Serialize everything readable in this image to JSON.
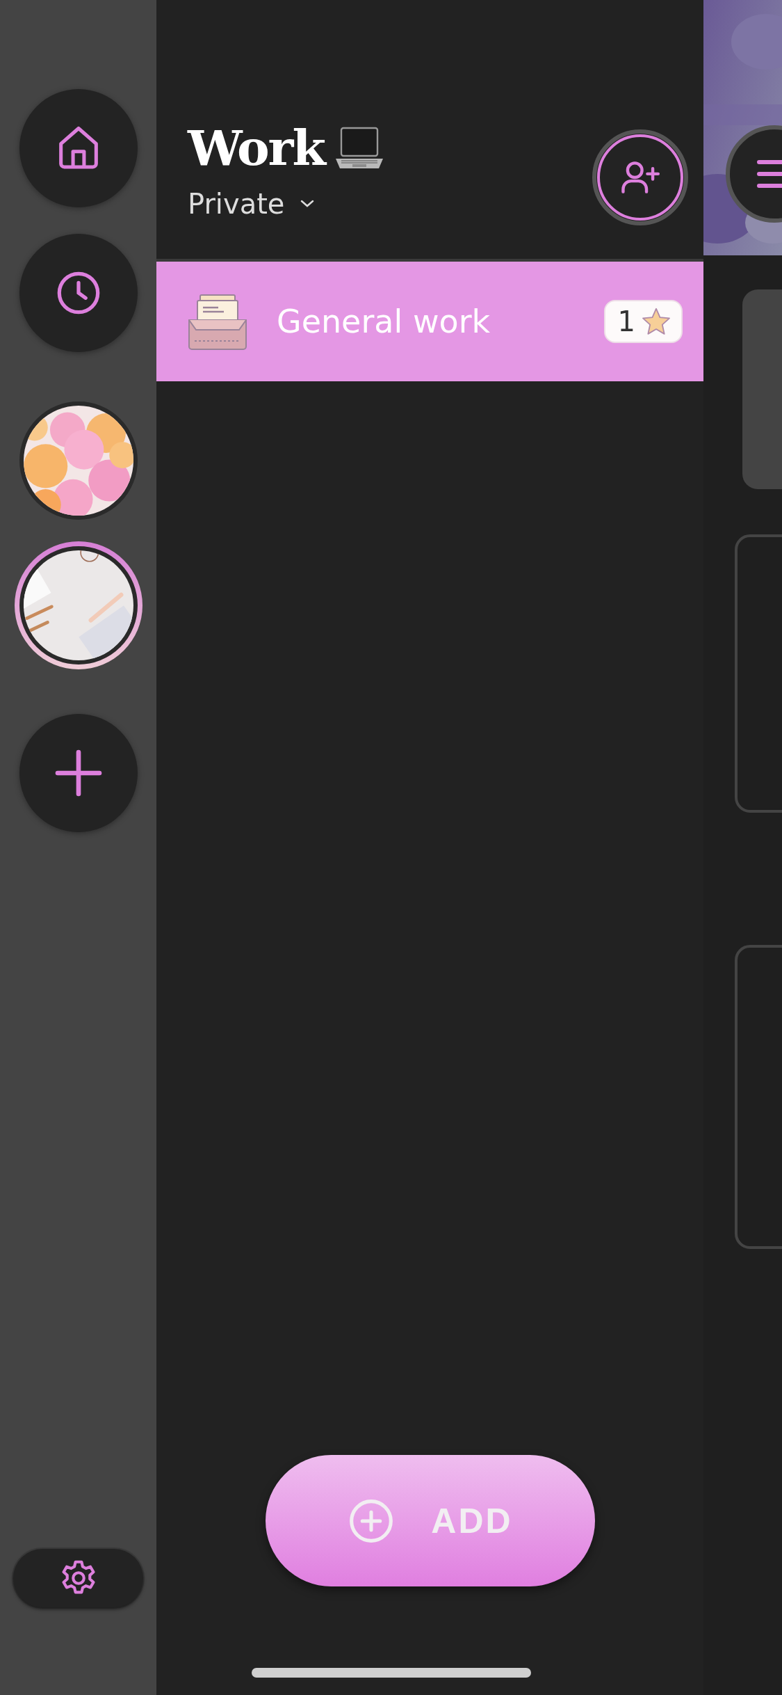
{
  "rail": {
    "items": [
      {
        "kind": "home",
        "selected": false
      },
      {
        "kind": "history",
        "selected": false
      },
      {
        "kind": "picture",
        "selected": false
      },
      {
        "kind": "picture",
        "selected": true
      },
      {
        "kind": "add",
        "selected": false
      }
    ]
  },
  "header": {
    "title": "Work",
    "subtitle": "Private"
  },
  "lists": [
    {
      "label": "General work",
      "count": "1",
      "selected": true
    }
  ],
  "add_button": {
    "label": "ADD"
  }
}
